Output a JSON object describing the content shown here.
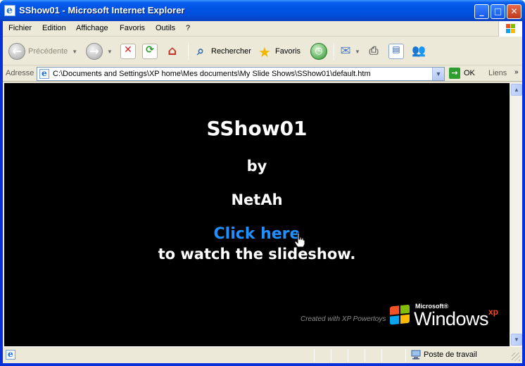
{
  "window": {
    "title": "SShow01 - Microsoft Internet Explorer",
    "controls": {
      "minimize": "_",
      "maximize": "□",
      "close": "✕"
    }
  },
  "menu": [
    "Fichier",
    "Edition",
    "Affichage",
    "Favoris",
    "Outils",
    "?"
  ],
  "toolbar": {
    "back_label": "Précédente",
    "search_label": "Rechercher",
    "favorites_label": "Favoris"
  },
  "address": {
    "label": "Adresse",
    "url": "C:\\Documents and Settings\\XP home\\Mes documents\\My Slide Shows\\SShow01\\default.htm",
    "go_label": "OK",
    "links_label": "Liens"
  },
  "page": {
    "title": "SShow01",
    "by": "by",
    "author": "NetAh",
    "link_text": "Click here",
    "subtitle": "to watch the slideshow.",
    "created_with_prefix": "Created with",
    "created_with_product": "XP Powertoys",
    "logo_microsoft": "Microsoft®",
    "logo_windows": "Windows",
    "logo_xp": "xp"
  },
  "status": {
    "zone": "Poste de travail"
  },
  "colors": {
    "link": "#1e90ff",
    "page_background": "#000000",
    "titlebar": "#0054e3"
  }
}
